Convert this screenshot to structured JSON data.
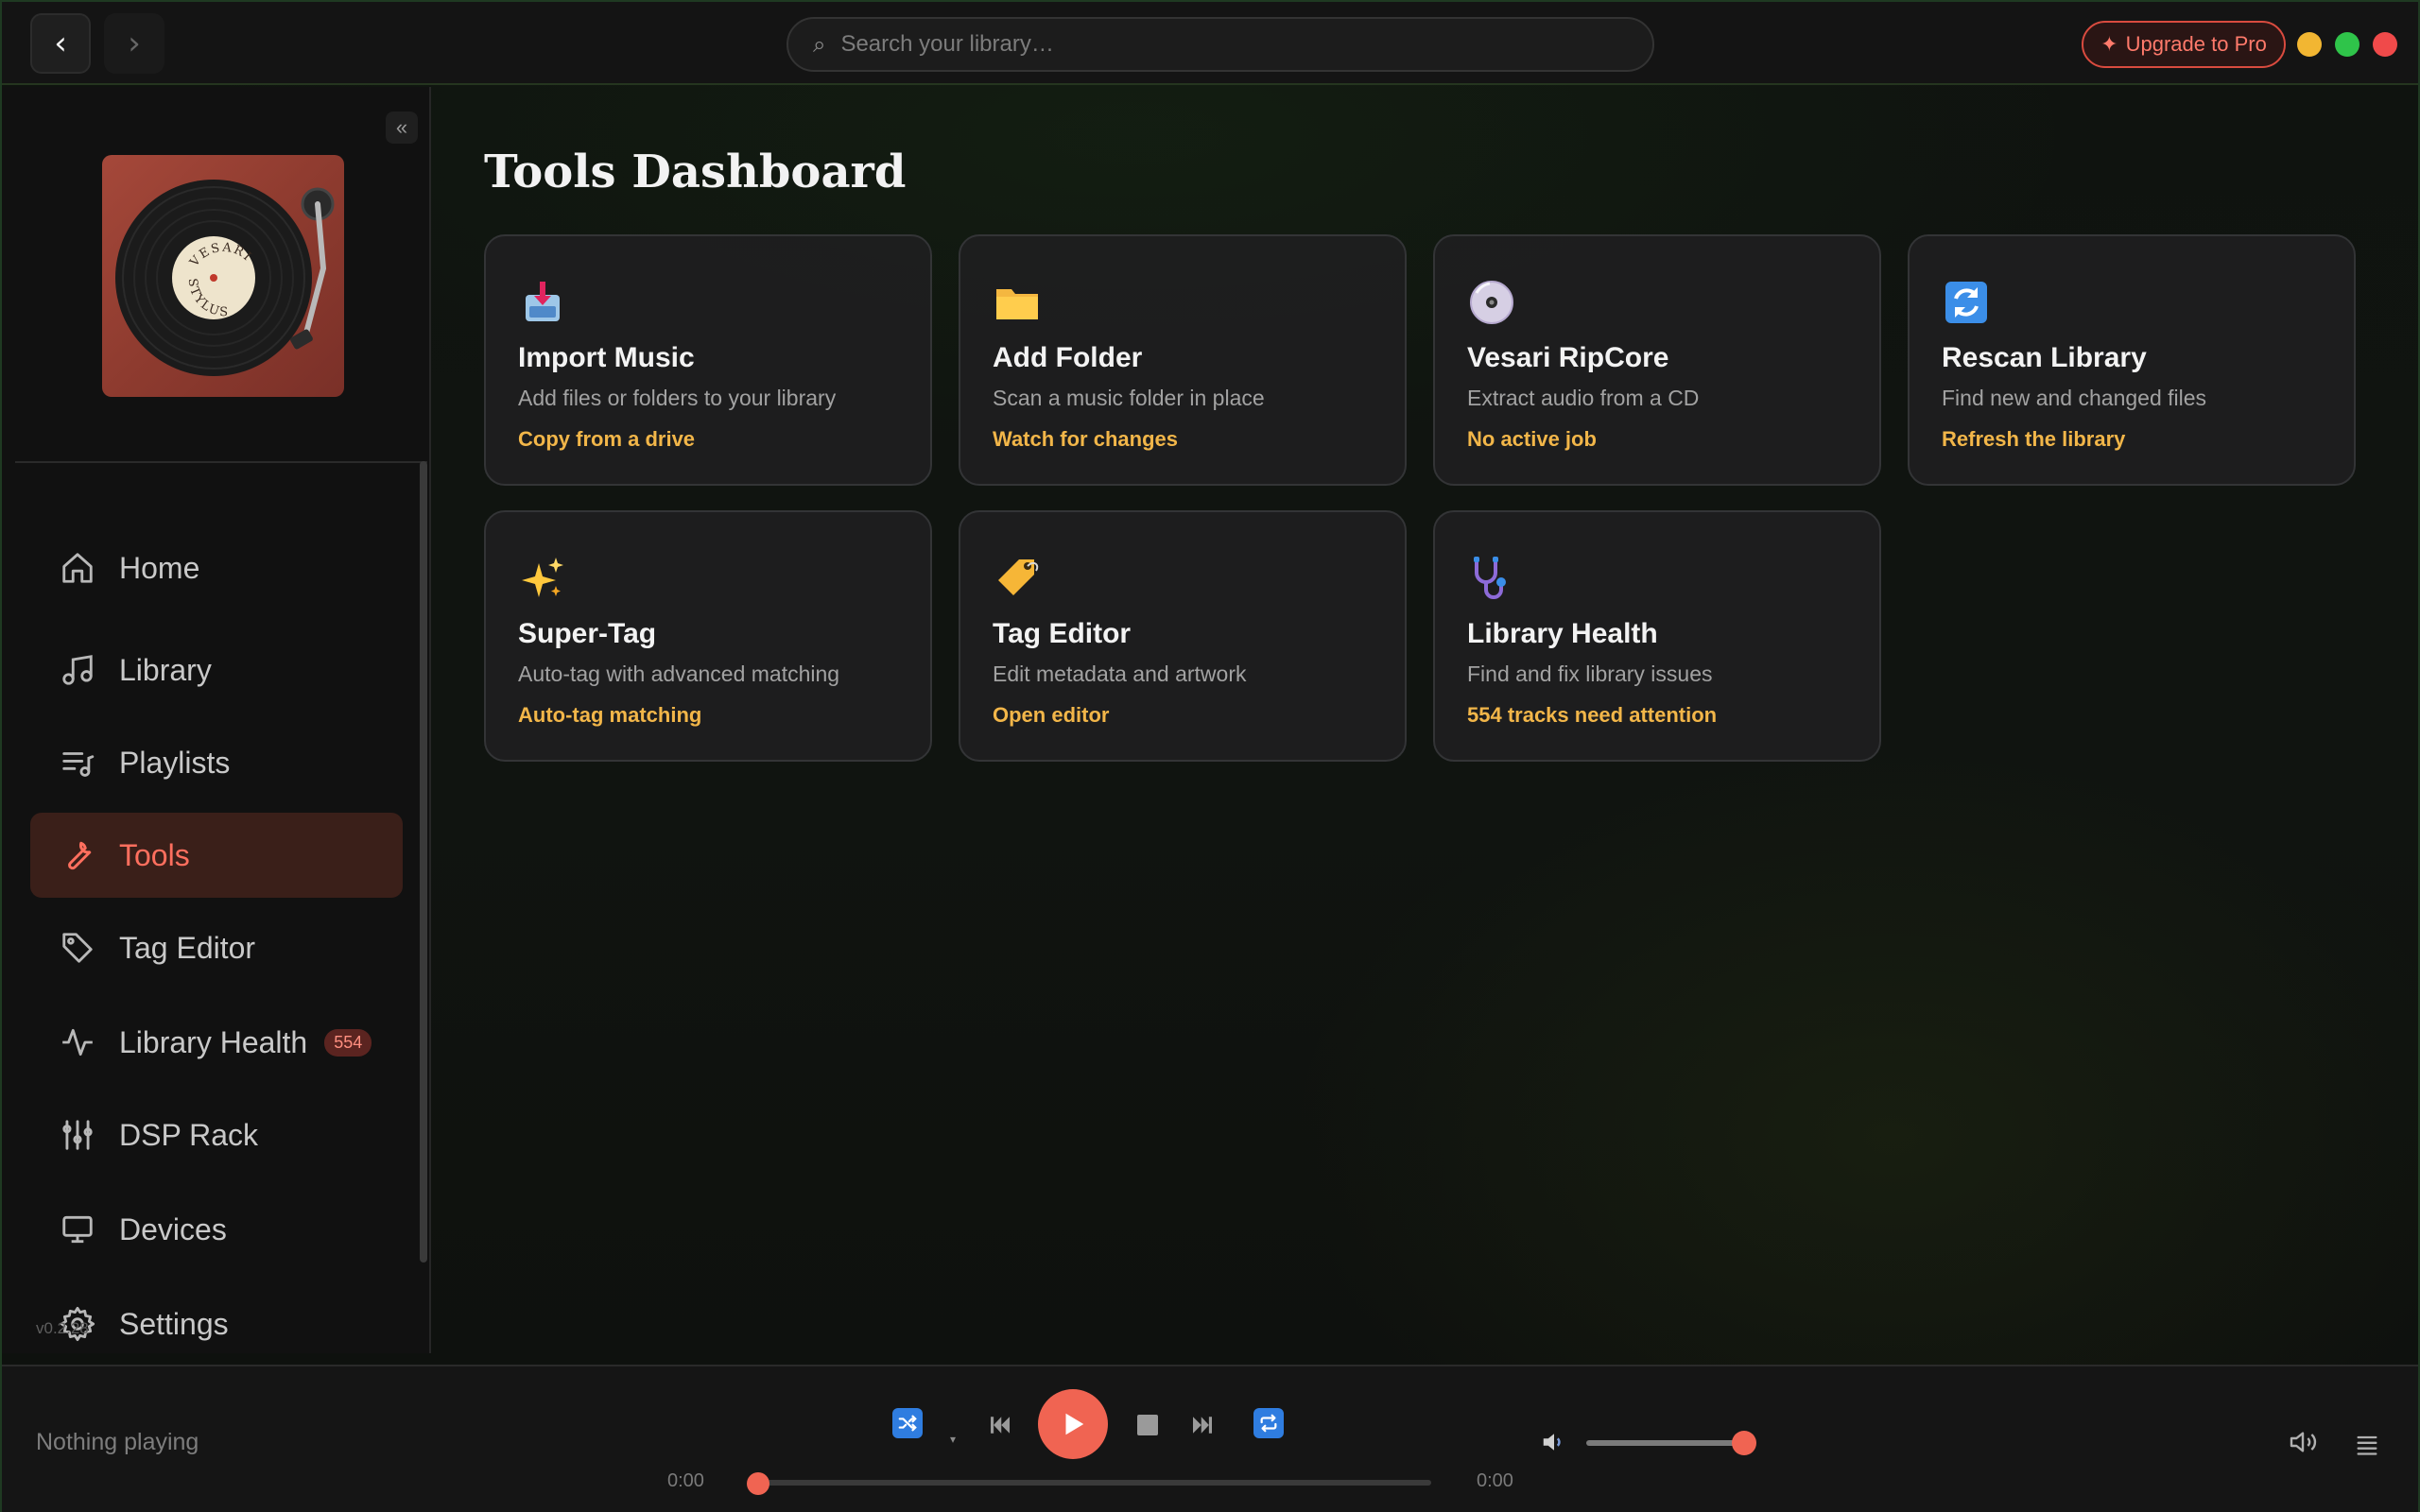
{
  "topbar": {
    "search_placeholder": "Search your library…",
    "upgrade_label": "Upgrade to Pro",
    "upgrade_icon": "✦"
  },
  "sidebar": {
    "collapse_glyph": "«",
    "cover_label_top": "VESARI",
    "cover_label_bottom": "STYLUS",
    "items": [
      {
        "label": "Home",
        "icon": "home-icon"
      },
      {
        "label": "Library",
        "icon": "music-note-icon"
      },
      {
        "label": "Playlists",
        "icon": "playlist-icon"
      },
      {
        "label": "Tools",
        "icon": "wrench-icon",
        "active": true
      },
      {
        "label": "Tag Editor",
        "icon": "tag-icon"
      },
      {
        "label": "Library Health",
        "icon": "pulse-icon",
        "badge": "554"
      },
      {
        "label": "DSP Rack",
        "icon": "sliders-icon"
      },
      {
        "label": "Devices",
        "icon": "monitor-icon"
      },
      {
        "label": "Settings",
        "icon": "gear-icon"
      }
    ],
    "version": "v0.2.28"
  },
  "main": {
    "title": "Tools Dashboard",
    "cards": [
      {
        "title": "Import Music",
        "desc": "Add files or folders to your library",
        "link": "Copy from a drive",
        "icon": "inbox-tray-icon"
      },
      {
        "title": "Add Folder",
        "desc": "Scan a music folder in place",
        "link": "Watch for changes",
        "icon": "folder-icon"
      },
      {
        "title": "Vesari RipCore",
        "desc": "Extract audio from a CD",
        "link": "No active job",
        "icon": "disc-icon"
      },
      {
        "title": "Rescan Library",
        "desc": "Find new and changed files",
        "link": "Refresh the library",
        "icon": "refresh-icon"
      },
      {
        "title": "Super-Tag",
        "desc": "Auto-tag with advanced matching",
        "link": "Auto-tag matching",
        "icon": "sparkles-icon"
      },
      {
        "title": "Tag Editor",
        "desc": "Edit metadata and artwork",
        "link": "Open editor",
        "icon": "label-tag-icon"
      },
      {
        "title": "Library Health",
        "desc": "Find and fix library issues",
        "link": "554 tracks need attention",
        "icon": "stethoscope-icon"
      }
    ]
  },
  "player": {
    "now_playing": "Nothing playing",
    "time_current": "0:00",
    "time_total": "0:00",
    "progress": 0,
    "volume": 0.93
  },
  "colors": {
    "accent": "#f06452",
    "link": "#f2b649",
    "active_bg": "#3a1f19"
  }
}
